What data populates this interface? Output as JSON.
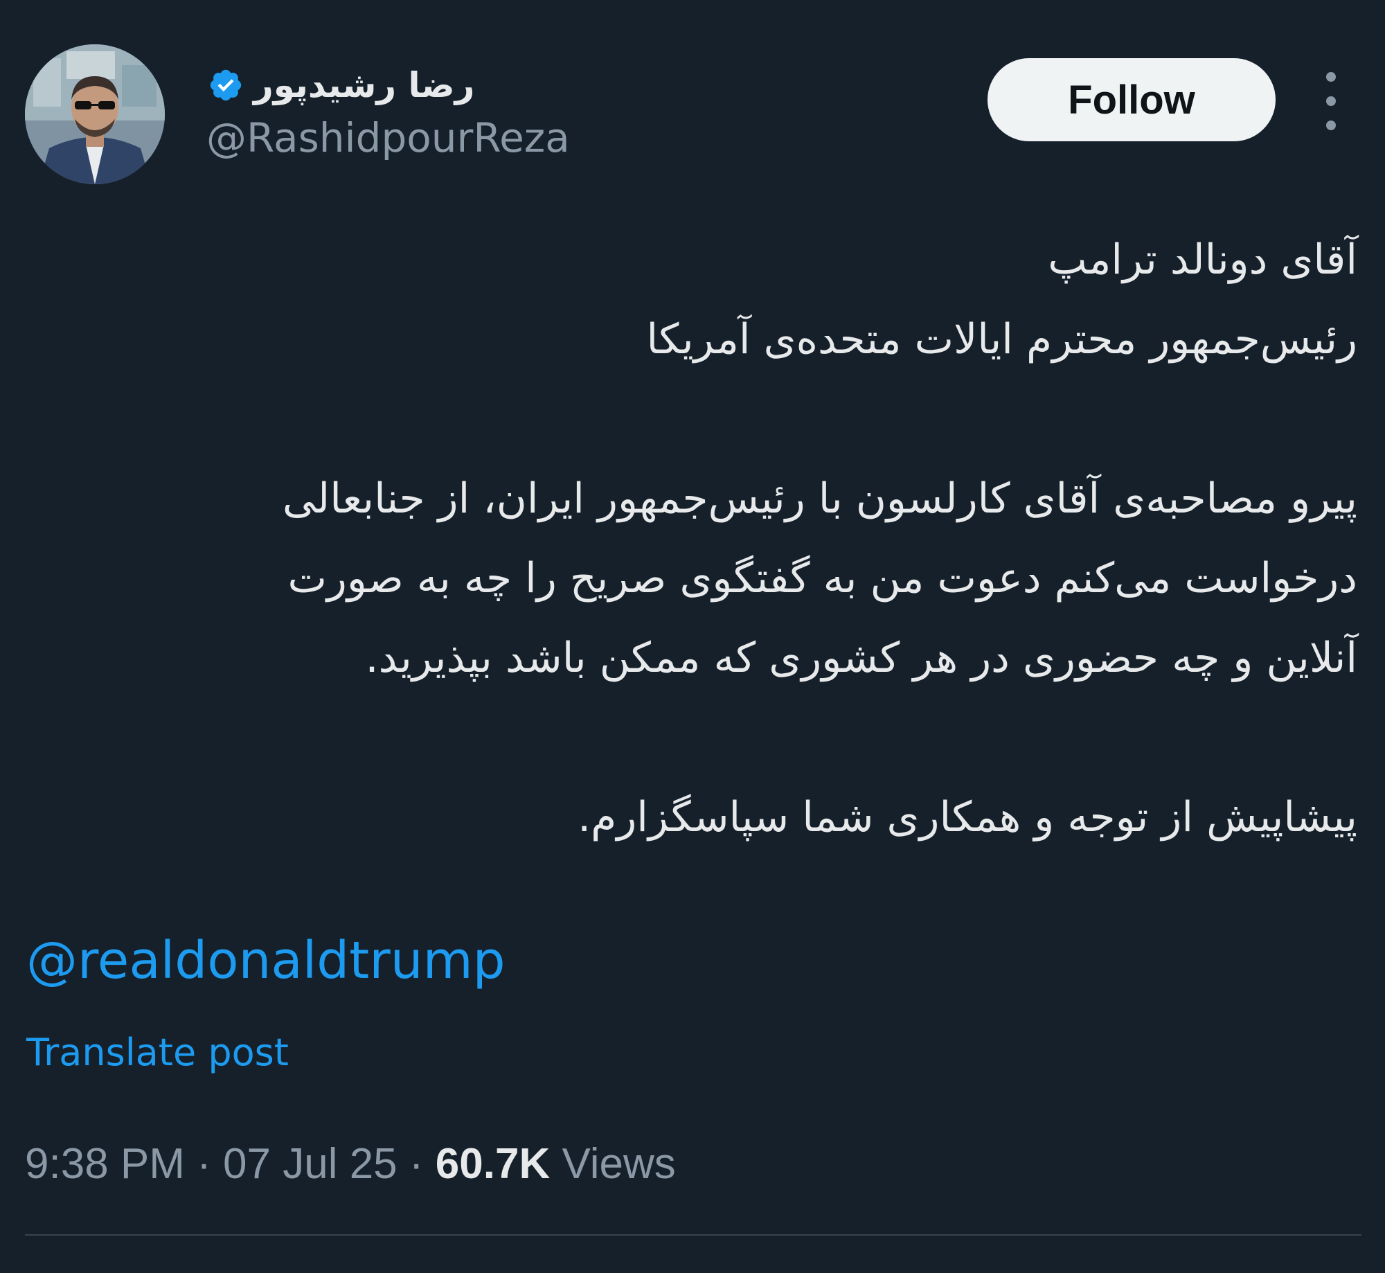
{
  "author": {
    "display_name": "رضا رشیدپور",
    "handle": "@RashidpourReza",
    "verified_icon": "verified-badge-icon",
    "avatar": "profile-photo"
  },
  "actions": {
    "follow_label": "Follow",
    "more_icon": "vertical-ellipsis-icon"
  },
  "tweet": {
    "lines": [
      "آقای دونالد ترامپ",
      "رئیس‌جمهور محترم ایالات متحده‌ی آمریکا",
      "",
      "پیرو مصاحبه‌ی آقای کارلسون با رئیس‌جمهور ایران، از جنابعالی",
      "درخواست می‌کنم دعوت من به گفتگوی صریح را چه به صورت",
      "آنلاین و چه حضوری در هر کشوری که ممکن باشد بپذیرید.",
      "",
      "پیشاپیش از توجه و همکاری شما سپاسگزارم."
    ],
    "mention": "@realdonaldtrump",
    "translate_label": "Translate post"
  },
  "meta": {
    "time": "9:38 PM",
    "separator": "·",
    "date": "07 Jul 25",
    "views_count": "60.7K",
    "views_label": "Views"
  },
  "colors": {
    "background": "#15202b",
    "text_primary": "#e7e9ea",
    "text_secondary": "#8b98a5",
    "link": "#1d9bf0",
    "verified": "#1d9bf0",
    "follow_bg": "#eff3f4"
  }
}
